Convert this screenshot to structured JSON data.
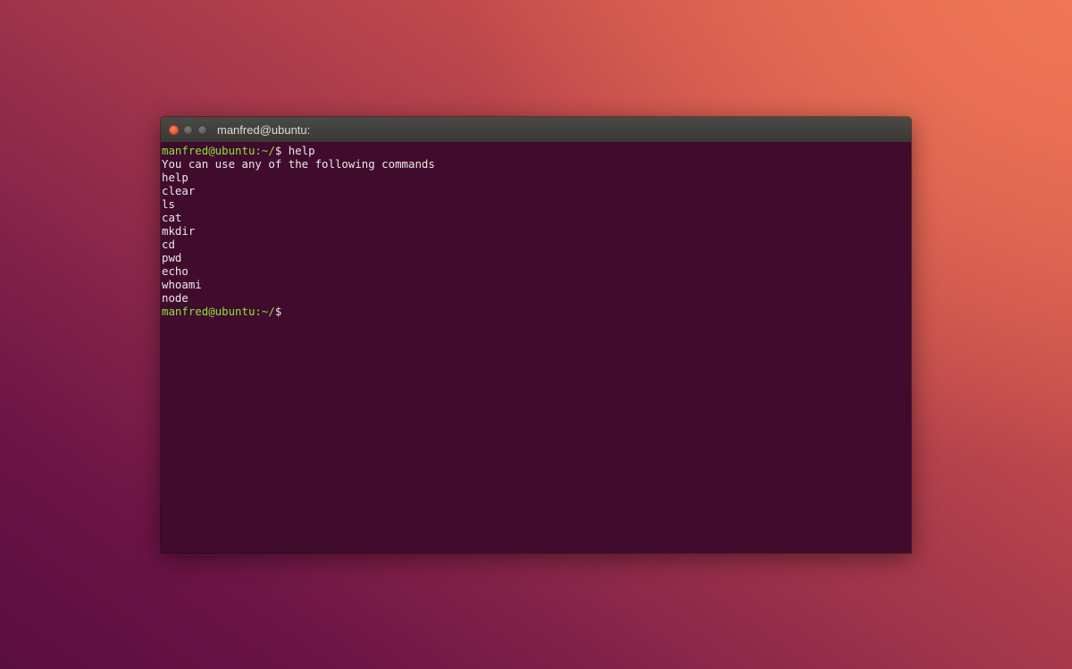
{
  "window": {
    "title": "manfred@ubuntu:",
    "controls": {
      "close": "close-icon",
      "minimize": "minimize-icon",
      "maximize": "maximize-icon"
    }
  },
  "colors": {
    "terminal_background": "#410b2e",
    "prompt": "#8ae234",
    "text": "#e9e9e5",
    "titlebar": "#3f3e3a",
    "close_button": "#e4572a"
  },
  "terminal": {
    "prompt_text": "manfred@ubuntu:",
    "prompt_path": "~/",
    "prompt_symbol": "$",
    "command": "help",
    "output": [
      "You can use any of the following commands",
      "help",
      "clear",
      "ls",
      "cat",
      "mkdir",
      "cd",
      "pwd",
      "echo",
      "whoami",
      "node"
    ]
  }
}
